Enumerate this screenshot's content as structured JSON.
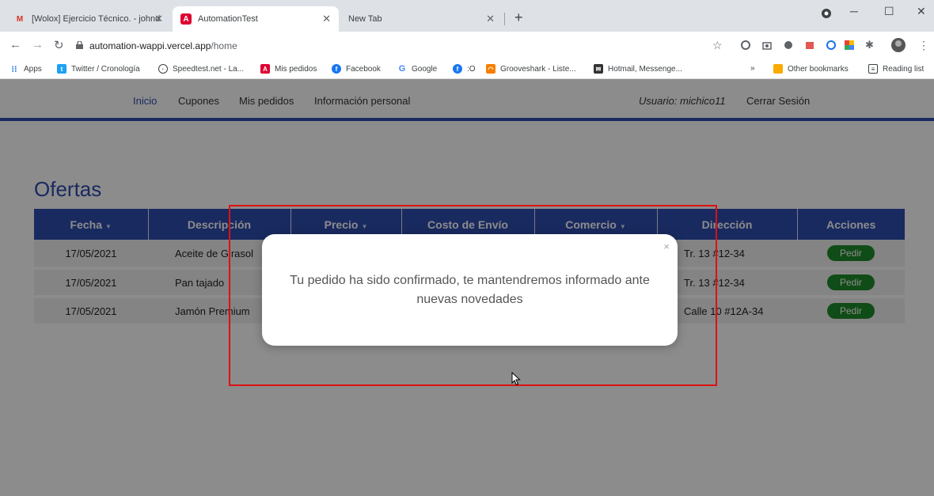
{
  "browser": {
    "tabs": [
      {
        "title": "[Wolox] Ejercicio Técnico. - johnd",
        "favicon": "gmail-icon"
      },
      {
        "title": "AutomationTest",
        "favicon": "angular-icon"
      },
      {
        "title": "New Tab",
        "favicon": ""
      }
    ],
    "url_host": "automation-wappi.vercel.app",
    "url_path": "/home",
    "bookmarks": [
      {
        "label": "Apps",
        "icon": "apps-grid-icon"
      },
      {
        "label": "Twitter / Cronología",
        "icon": "twitter-icon"
      },
      {
        "label": "Speedtest.net - La...",
        "icon": "speedtest-icon"
      },
      {
        "label": "Mis pedidos",
        "icon": "angular-icon"
      },
      {
        "label": "Facebook",
        "icon": "facebook-icon"
      },
      {
        "label": "Google",
        "icon": "google-icon"
      },
      {
        "label": ":O",
        "icon": "facebook-icon"
      },
      {
        "label": "Grooveshark - Liste...",
        "icon": "grooveshark-icon"
      },
      {
        "label": "Hotmail, Messenge...",
        "icon": "hotmail-icon"
      },
      {
        "label": "»",
        "icon": ""
      },
      {
        "label": "Other bookmarks",
        "icon": "folder-icon"
      },
      {
        "label": "Reading list",
        "icon": "reading-list-icon"
      }
    ]
  },
  "nav": {
    "inicio": "Inicio",
    "cupones": "Cupones",
    "mis_pedidos": "Mis pedidos",
    "info": "Información personal",
    "user": "Usuario: michico11",
    "logout": "Cerrar Sesión"
  },
  "main": {
    "heading": "Ofertas",
    "columns": [
      "Fecha",
      "Descripción",
      "Precio",
      "Costo de Envío",
      "Comercio",
      "Dirección",
      "Acciones"
    ],
    "sort_indicator": "▼",
    "rows": [
      {
        "fecha": "17/05/2021",
        "descripcion": "Aceite de Girasol",
        "direccion": "Tr. 13 #12-34",
        "accion": "Pedir"
      },
      {
        "fecha": "17/05/2021",
        "descripcion": "Pan tajado",
        "direccion": "Tr. 13 #12-34",
        "accion": "Pedir"
      },
      {
        "fecha": "17/05/2021",
        "descripcion": "Jamón Premium",
        "direccion": "Calle 10 #12A-34",
        "accion": "Pedir"
      }
    ]
  },
  "modal": {
    "close": "×",
    "message": "Tu pedido ha sido confirmado, te mantendremos informado ante nuevas novedades"
  },
  "colors": {
    "primary": "#2f4db0",
    "action": "#1e8a2a",
    "highlight": "#dd1111"
  }
}
